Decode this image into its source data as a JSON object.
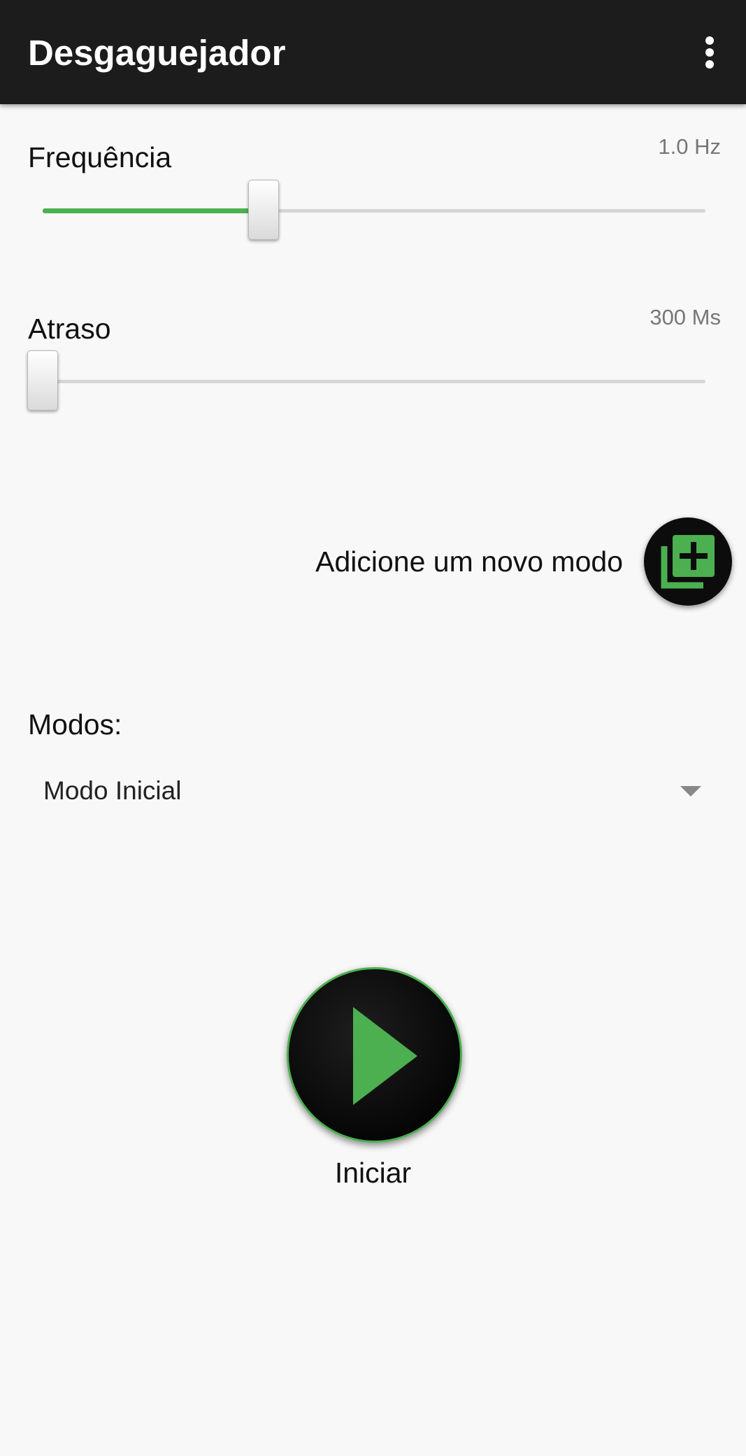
{
  "appbar": {
    "title": "Desgaguejador",
    "menu_icon": "more-vert-icon"
  },
  "frequency": {
    "label": "Frequência",
    "value_text": "1.0 Hz",
    "slider_fraction": 0.333
  },
  "delay": {
    "label": "Atraso",
    "value_text": "300 Ms",
    "slider_fraction": 0.0
  },
  "add_mode": {
    "label": "Adicione um novo modo",
    "icon": "library-add-icon"
  },
  "modes": {
    "label": "Modos:",
    "selected": "Modo Inicial",
    "arrow_icon": "dropdown-arrow-icon"
  },
  "start": {
    "label": "Iniciar",
    "icon": "play-icon"
  },
  "colors": {
    "accent": "#4caf50",
    "appbar": "#1c1c1c",
    "background": "#f8f8f8",
    "button_dark": "#0c0c0c"
  }
}
